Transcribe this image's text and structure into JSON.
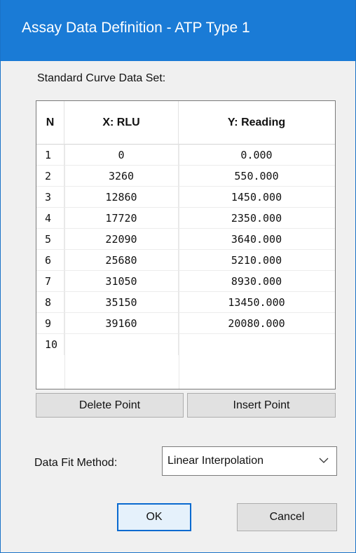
{
  "window": {
    "title": "Assay Data Definition - ATP Type 1"
  },
  "section_label": "Standard Curve Data Set:",
  "table": {
    "headers": [
      "N",
      "X: RLU",
      "Y: Reading"
    ],
    "rows": [
      {
        "n": "1",
        "x": "0",
        "y": "0.000"
      },
      {
        "n": "2",
        "x": "3260",
        "y": "550.000"
      },
      {
        "n": "3",
        "x": "12860",
        "y": "1450.000"
      },
      {
        "n": "4",
        "x": "17720",
        "y": "2350.000"
      },
      {
        "n": "5",
        "x": "22090",
        "y": "3640.000"
      },
      {
        "n": "6",
        "x": "25680",
        "y": "5210.000"
      },
      {
        "n": "7",
        "x": "31050",
        "y": "8930.000"
      },
      {
        "n": "8",
        "x": "35150",
        "y": "13450.000"
      },
      {
        "n": "9",
        "x": "39160",
        "y": "20080.000"
      },
      {
        "n": "10",
        "x": "",
        "y": ""
      }
    ]
  },
  "buttons": {
    "delete_point": "Delete Point",
    "insert_point": "Insert Point",
    "ok": "OK",
    "cancel": "Cancel"
  },
  "fit_method": {
    "label": "Data Fit Method:",
    "selected": "Linear Interpolation",
    "icon": "chevron-down-icon"
  },
  "colors": {
    "title_bar": "#1a7bd6",
    "default_button_border": "#0a6ad0"
  }
}
